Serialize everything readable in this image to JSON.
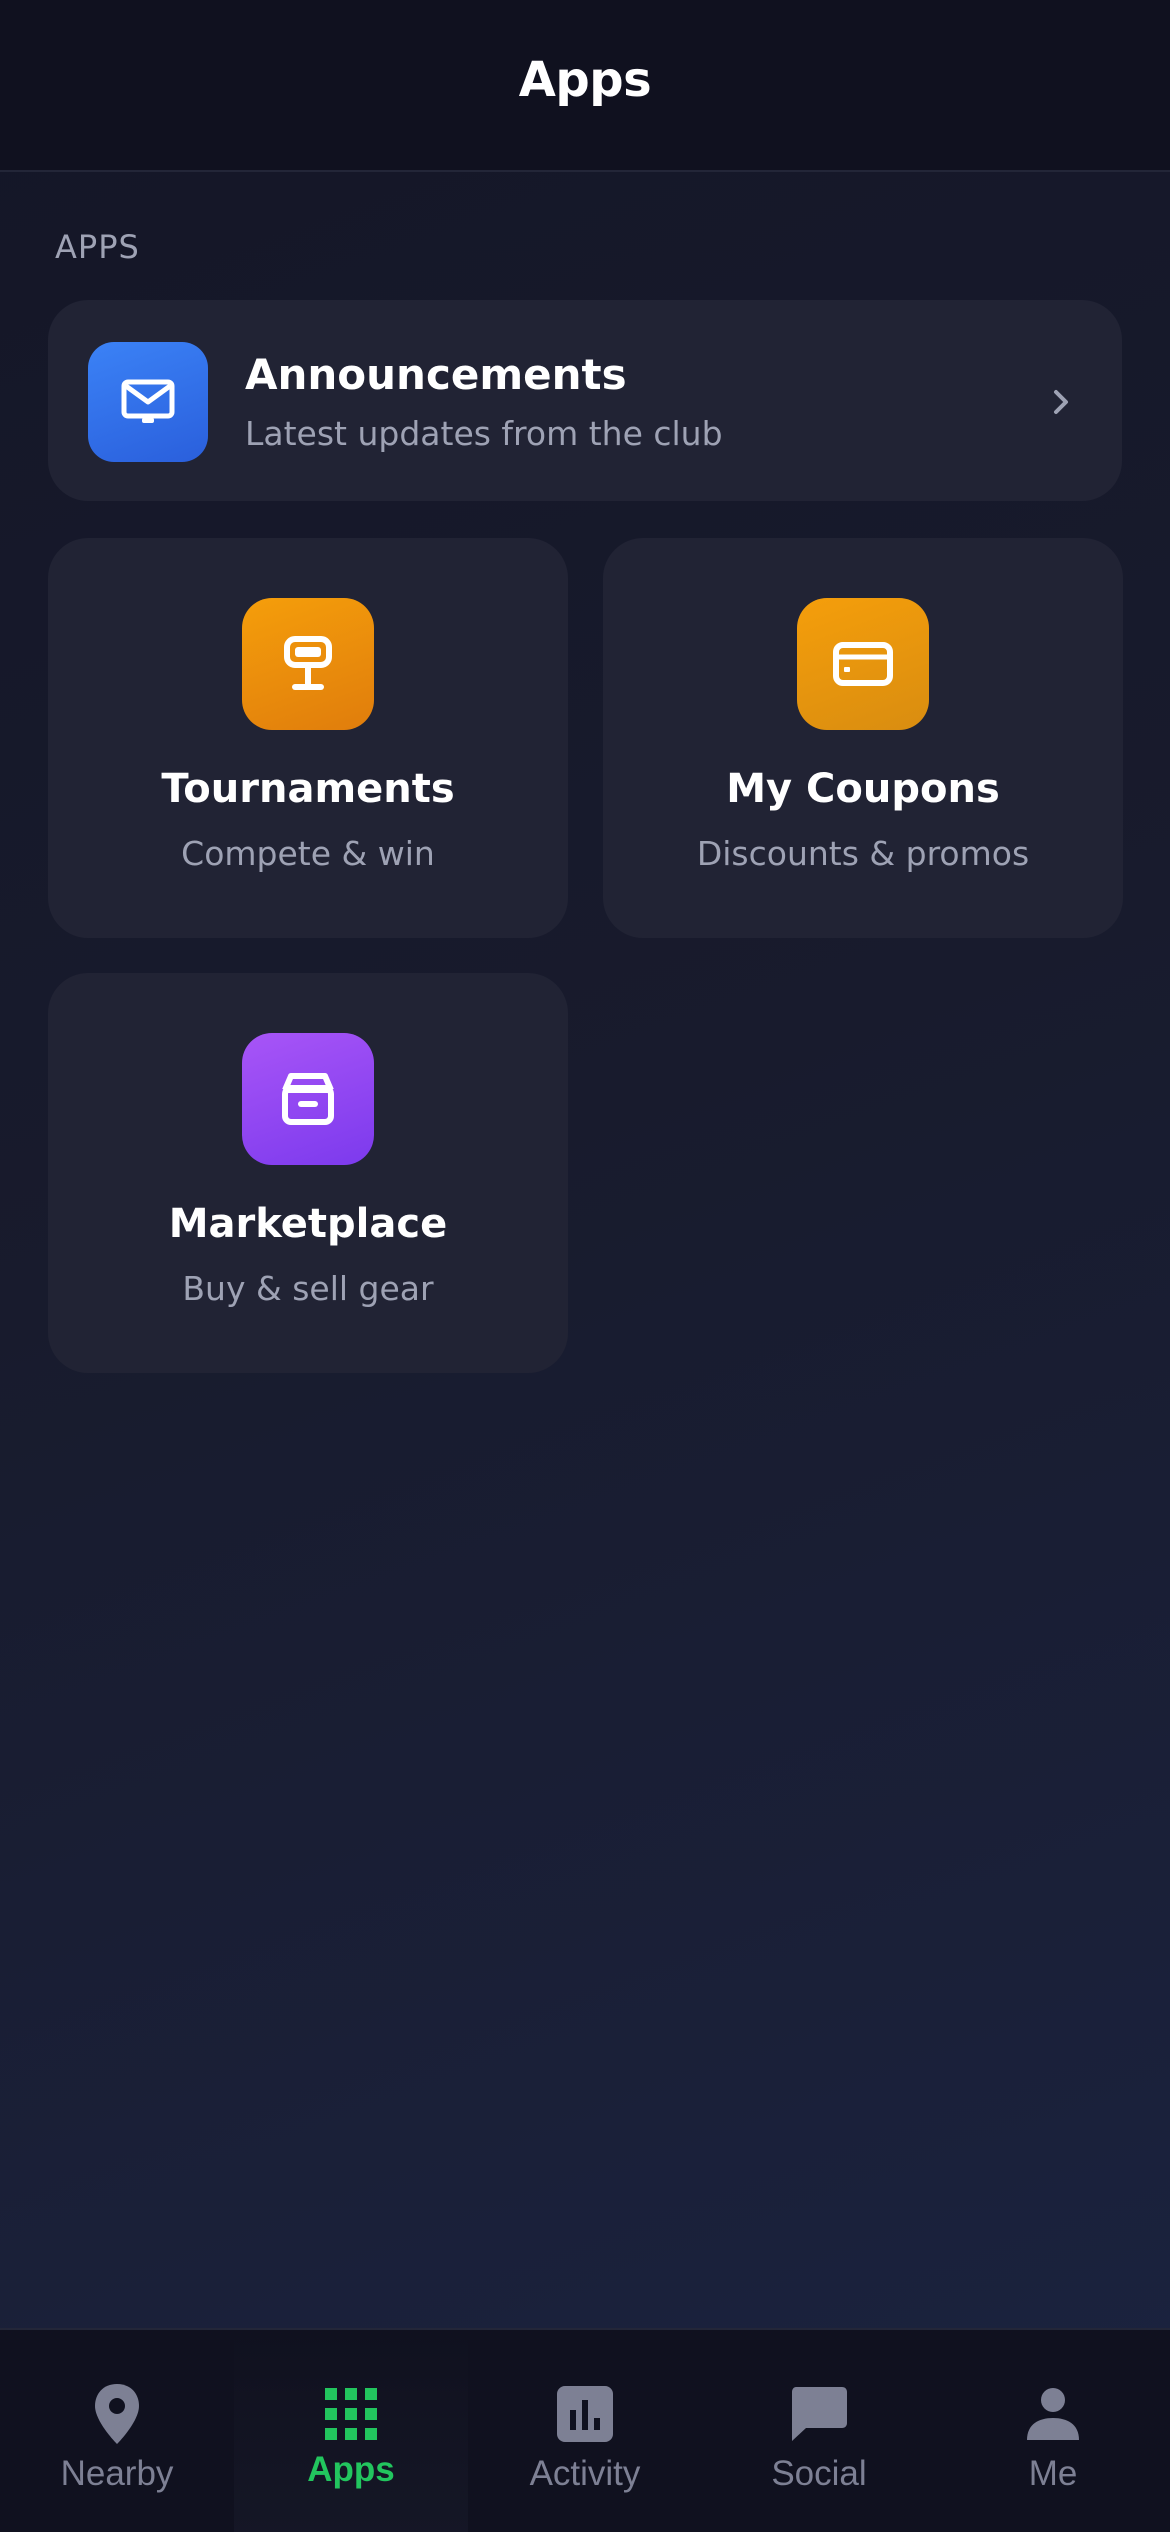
{
  "header": {
    "title": "Apps"
  },
  "section": {
    "label": "APPS"
  },
  "announcements": {
    "title": "Announcements",
    "subtitle": "Latest updates from the club",
    "icon": "mail-icon",
    "icon_color": "#3b82f6"
  },
  "tiles": [
    {
      "title": "Tournaments",
      "subtitle": "Compete & win",
      "icon": "trophy-icon",
      "icon_color": "#f59e0b"
    },
    {
      "title": "My Coupons",
      "subtitle": "Discounts & promos",
      "icon": "credit-card-icon",
      "icon_color": "#f59e0b"
    },
    {
      "title": "Marketplace",
      "subtitle": "Buy & sell gear",
      "icon": "archive-box-icon",
      "icon_color": "#a855f7"
    }
  ],
  "tabbar": {
    "active": "Apps",
    "active_color": "#22c55e",
    "items": [
      {
        "label": "Nearby",
        "icon": "location-pin-icon"
      },
      {
        "label": "Apps",
        "icon": "grid-icon"
      },
      {
        "label": "Activity",
        "icon": "bar-chart-icon"
      },
      {
        "label": "Social",
        "icon": "chat-bubble-icon"
      },
      {
        "label": "Me",
        "icon": "person-icon"
      }
    ]
  }
}
